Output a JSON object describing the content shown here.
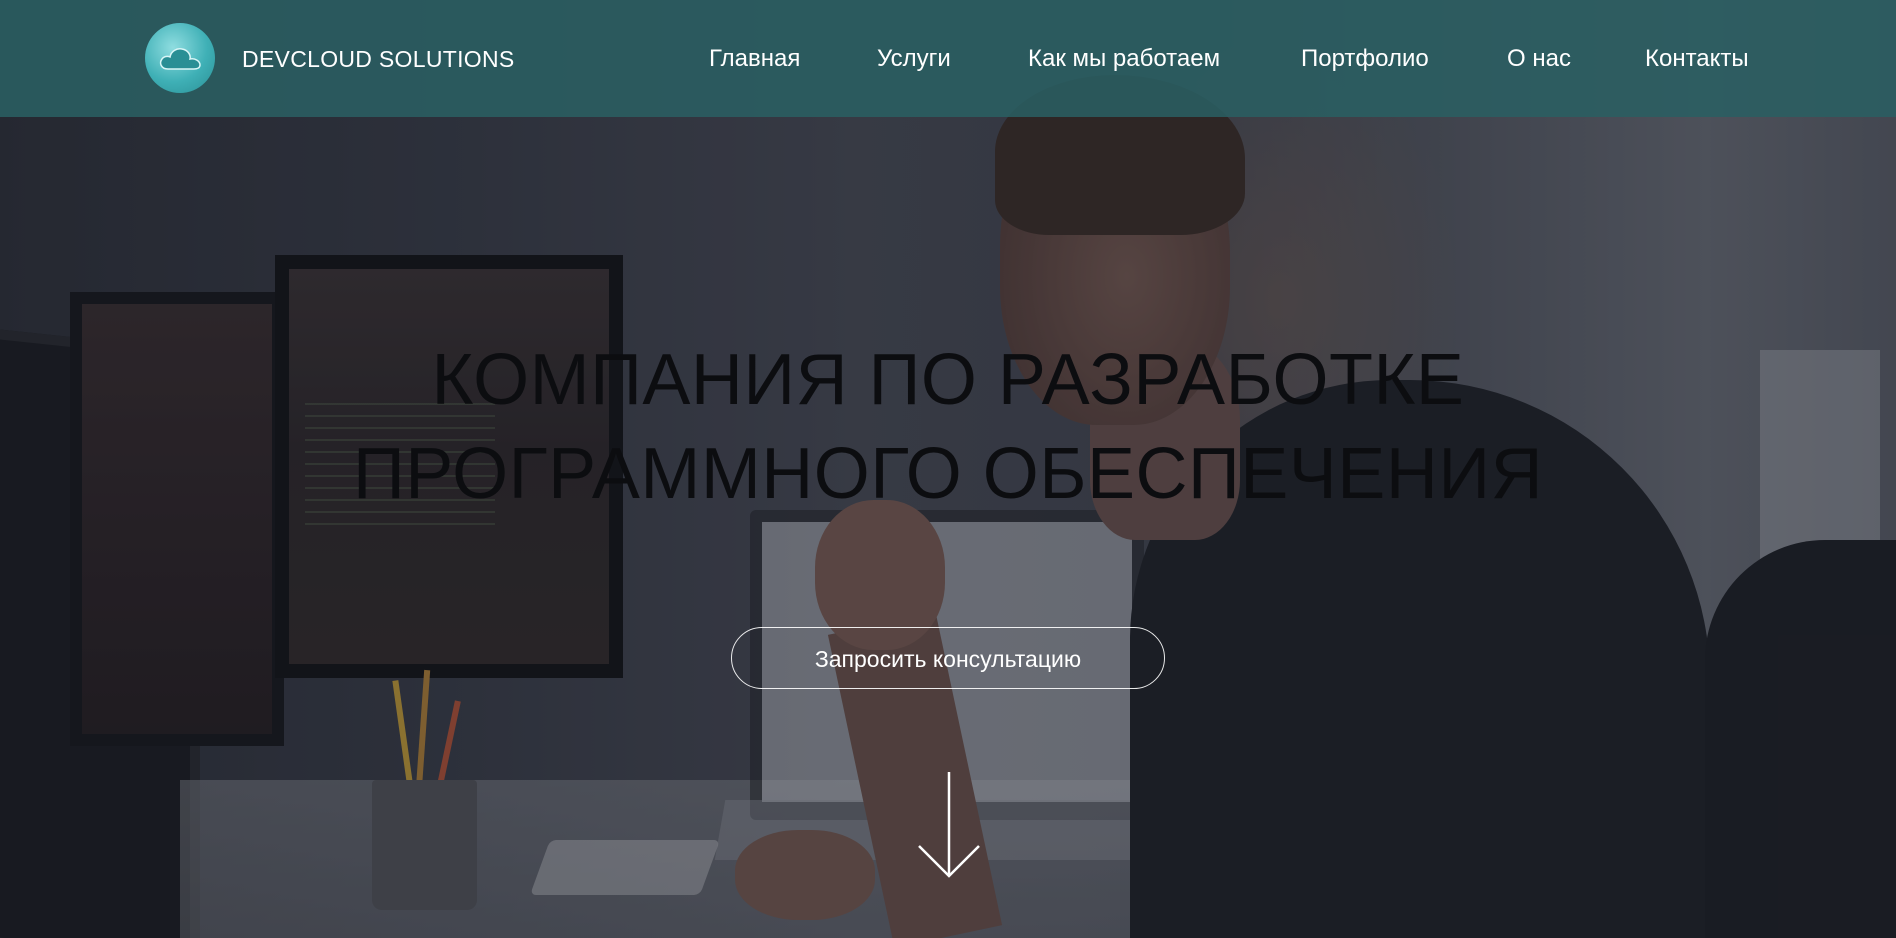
{
  "header": {
    "brand_name": "DEVCLOUD SOLUTIONS",
    "logo_icon": "cloud-icon",
    "nav": [
      {
        "label": "Главная"
      },
      {
        "label": "Услуги"
      },
      {
        "label": "Как мы работаем"
      },
      {
        "label": "Портфолио"
      },
      {
        "label": "О нас"
      },
      {
        "label": "Контакты"
      }
    ]
  },
  "hero": {
    "title_line1": "КОМПАНИЯ ПО РАЗРАБОТКЕ",
    "title_line2": "ПРОГРАММНОГО ОБЕСПЕЧЕНИЯ",
    "cta_label": "Запросить консультацию",
    "scroll_icon": "arrow-down-icon"
  },
  "colors": {
    "navbar_bg": "#2a5f62",
    "logo_accent": "#3fb0b6",
    "headline": "#0c0d10",
    "text_light": "#ffffff"
  }
}
